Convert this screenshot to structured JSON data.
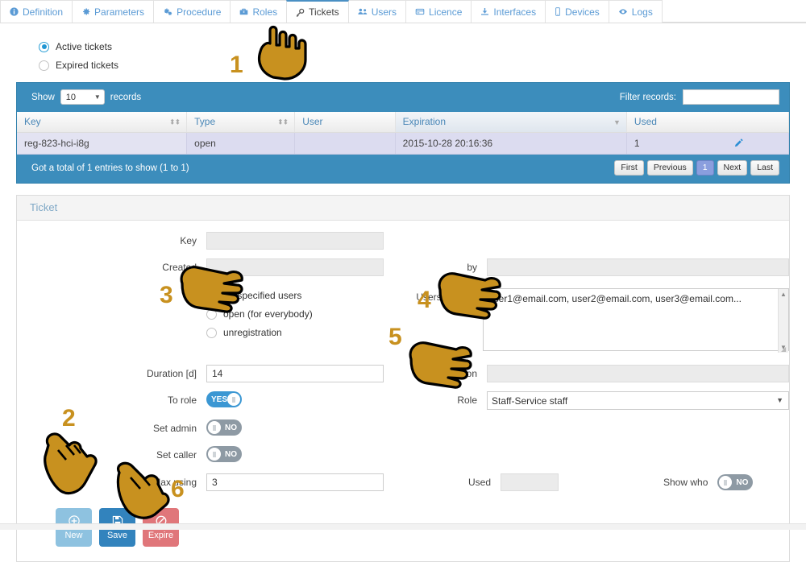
{
  "tabs": [
    {
      "label": "Definition",
      "icon": "info-icon",
      "active": false
    },
    {
      "label": "Parameters",
      "icon": "gear-icon",
      "active": false
    },
    {
      "label": "Procedure",
      "icon": "gears-icon",
      "active": false
    },
    {
      "label": "Roles",
      "icon": "briefcase-icon",
      "active": false
    },
    {
      "label": "Tickets",
      "icon": "key-icon",
      "active": true
    },
    {
      "label": "Users",
      "icon": "users-icon",
      "active": false
    },
    {
      "label": "Licence",
      "icon": "card-icon",
      "active": false
    },
    {
      "label": "Interfaces",
      "icon": "download-icon",
      "active": false
    },
    {
      "label": "Devices",
      "icon": "mobile-icon",
      "active": false
    },
    {
      "label": "Logs",
      "icon": "eye-icon",
      "active": false
    }
  ],
  "ticket_filter": {
    "options": [
      {
        "label": "Active tickets",
        "selected": true
      },
      {
        "label": "Expired tickets",
        "selected": false
      }
    ]
  },
  "datatable": {
    "show_label": "Show",
    "show_value": "10",
    "records_label": "records",
    "filter_label": "Filter records:",
    "filter_value": "",
    "filter_placeholder": "",
    "columns": [
      {
        "label": "Key",
        "sortable": true,
        "sorted": false
      },
      {
        "label": "Type",
        "sortable": true,
        "sorted": false
      },
      {
        "label": "User",
        "sortable": false,
        "sorted": false
      },
      {
        "label": "Expiration",
        "sortable": true,
        "sorted": true
      },
      {
        "label": "Used",
        "sortable": false,
        "sorted": false
      }
    ],
    "rows": [
      {
        "key": "reg-823-hci-i8g",
        "type": "open",
        "user": "",
        "expiration": "2015-10-28 20:16:36",
        "used": "1",
        "edit_icon": "pencil-icon"
      }
    ],
    "info": "Got a total of 1 entries to show (1 to 1)",
    "pager": {
      "first": "First",
      "previous": "Previous",
      "current": "1",
      "next": "Next",
      "last": "Last"
    }
  },
  "form": {
    "title": "Ticket",
    "key": {
      "label": "Key",
      "value": "",
      "readonly": true
    },
    "created": {
      "label": "Created",
      "value": "",
      "readonly": true
    },
    "by": {
      "label": "by",
      "value": "",
      "readonly": true
    },
    "scope": {
      "options": [
        {
          "label": "for specified users",
          "selected": true
        },
        {
          "label": "open (for everybody)",
          "selected": false
        },
        {
          "label": "unregistration",
          "selected": false
        }
      ]
    },
    "users_mails": {
      "label": "Users (Mails)",
      "value": "user1@email.com, user2@email.com, user3@email.com..."
    },
    "duration": {
      "label": "Duration [d]",
      "value": "14"
    },
    "expiration": {
      "label": "Expiration",
      "value": "",
      "readonly": true
    },
    "to_role": {
      "label": "To role",
      "state": "YES"
    },
    "role": {
      "label": "Role",
      "value": "Staff-Service staff"
    },
    "set_admin": {
      "label": "Set admin",
      "state": "NO"
    },
    "set_caller": {
      "label": "Set caller",
      "state": "NO"
    },
    "max_using": {
      "label": "Max using",
      "value": "3"
    },
    "used": {
      "label": "Used",
      "value": "",
      "readonly": true
    },
    "show_who": {
      "label": "Show who",
      "state": "NO"
    },
    "buttons": [
      {
        "label": "New",
        "icon": "plus-circle-icon",
        "style": "new"
      },
      {
        "label": "Save",
        "icon": "floppy-icon",
        "style": "save"
      },
      {
        "label": "Expire",
        "icon": "ban-icon",
        "style": "expire"
      }
    ]
  },
  "annotations": [
    {
      "number": "1",
      "points": "up"
    },
    {
      "number": "2",
      "points": "down"
    },
    {
      "number": "3",
      "points": "right"
    },
    {
      "number": "4",
      "points": "right"
    },
    {
      "number": "5",
      "points": "right"
    },
    {
      "number": "6",
      "points": "down-right"
    }
  ],
  "colors": {
    "accent_blue": "#3c8dbc",
    "tab_link": "#5b9bd5",
    "row_highlight": "#dcdcf0",
    "hand": "#c8911f",
    "toggle_on": "#3b97d3",
    "toggle_off": "#8e9aa4"
  }
}
